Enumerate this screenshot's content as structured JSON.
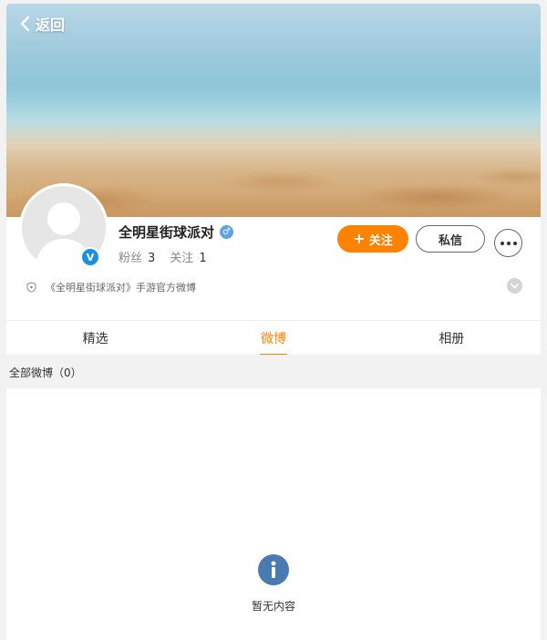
{
  "header": {
    "back_label": "返回"
  },
  "profile": {
    "name": "全明星街球派对",
    "gender_icon": "male-icon",
    "verified": true,
    "fans_label": "粉丝",
    "fans_count": "3",
    "following_label": "关注",
    "following_count": "1",
    "description": "《全明星街球派对》手游官方微博"
  },
  "actions": {
    "follow_label": "关注",
    "message_label": "私信"
  },
  "tabs": [
    {
      "label": "精选",
      "active": false
    },
    {
      "label": "微博",
      "active": true
    },
    {
      "label": "相册",
      "active": false
    }
  ],
  "feed": {
    "section_label": "全部微博（0）",
    "empty_text": "暂无内容"
  },
  "colors": {
    "accent": "#ff8200",
    "verified_blue": "#1d8fe2",
    "info_icon": "#4a7bb0"
  }
}
